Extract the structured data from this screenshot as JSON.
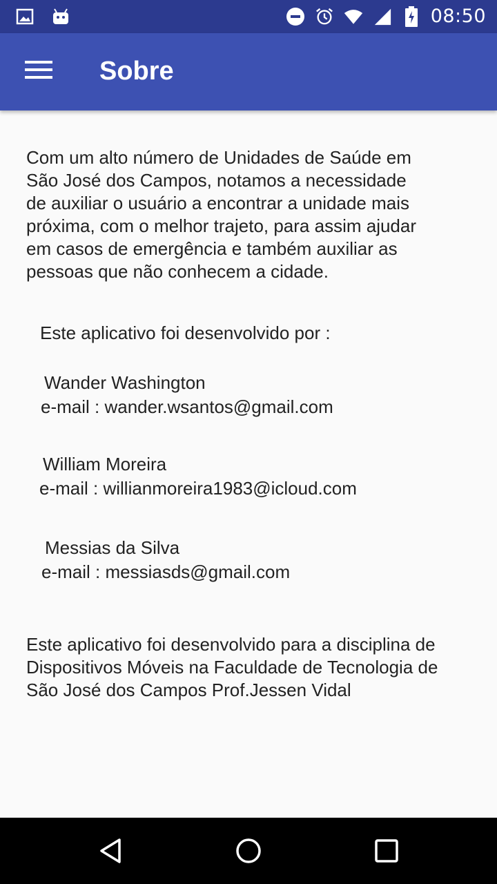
{
  "status_bar": {
    "time": "08:50",
    "icons_left": [
      "image-icon",
      "android-icon"
    ],
    "icons_right": [
      "do-not-disturb-icon",
      "alarm-icon",
      "wifi-icon",
      "signal-icon",
      "battery-charging-icon"
    ]
  },
  "app_bar": {
    "title": "Sobre",
    "menu_icon": "hamburger-menu-icon",
    "color": "#3d51b2"
  },
  "content": {
    "intro": "Com um alto número de Unidades de Saúde em\nSão José dos Campos, notamos a necessidade\nde auxiliar o usuário a encontrar a unidade mais\npróxima, com o melhor trajeto, para  assim ajudar\nem casos de emergência e também auxiliar as\npessoas que não conhecem a cidade.",
    "developed_by": "Este aplicativo foi desenvolvido por :",
    "developers": [
      {
        "name": "Wander Washington",
        "email": "e-mail : wander.wsantos@gmail.com"
      },
      {
        "name": "William Moreira",
        "email": "e-mail : willianmoreira1983@icloud.com"
      },
      {
        "name": "Messias da Silva",
        "email": "e-mail : messiasds@gmail.com"
      }
    ],
    "outro": "Este aplicativo foi desenvolvido para a disciplina de\nDispositivos Móveis na Faculdade de Tecnologia de\nSão José dos Campos Prof.Jessen Vidal"
  },
  "nav_bar": {
    "buttons": [
      "back-icon",
      "home-icon",
      "recents-icon"
    ]
  }
}
